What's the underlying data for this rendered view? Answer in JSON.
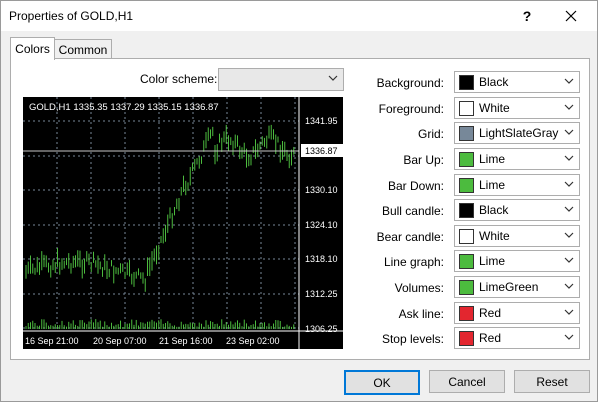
{
  "window": {
    "title": "Properties of GOLD,H1",
    "help_label": "?"
  },
  "tabs": [
    {
      "label": "Colors"
    },
    {
      "label": "Common"
    }
  ],
  "color_scheme": {
    "label": "Color scheme:",
    "value": ""
  },
  "chart": {
    "info_text": "GOLD,H1  1335.35 1337.29 1335.15 1336.87",
    "price_labels": [
      "1341.95",
      "1336.87",
      "1330.10",
      "1324.10",
      "1318.10",
      "1312.25",
      "1306.25"
    ],
    "time_labels": [
      "16 Sep 21:00",
      "20 Sep 07:00",
      "21 Sep 16:00",
      "23 Sep 02:00"
    ]
  },
  "color_rows": [
    {
      "label": "Background:",
      "value": "Black",
      "swatch": "#000000"
    },
    {
      "label": "Foreground:",
      "value": "White",
      "swatch": "#ffffff"
    },
    {
      "label": "Grid:",
      "value": "LightSlateGray",
      "swatch": "#778899"
    },
    {
      "label": "Bar Up:",
      "value": "Lime",
      "swatch": "#4cbb3e"
    },
    {
      "label": "Bar Down:",
      "value": "Lime",
      "swatch": "#4cbb3e"
    },
    {
      "label": "Bull candle:",
      "value": "Black",
      "swatch": "#000000"
    },
    {
      "label": "Bear candle:",
      "value": "White",
      "swatch": "#ffffff"
    },
    {
      "label": "Line graph:",
      "value": "Lime",
      "swatch": "#4cbb3e"
    },
    {
      "label": "Volumes:",
      "value": "LimeGreen",
      "swatch": "#4cbb3e"
    },
    {
      "label": "Ask line:",
      "value": "Red",
      "swatch": "#e3262f"
    },
    {
      "label": "Stop levels:",
      "value": "Red",
      "swatch": "#e3262f"
    }
  ],
  "buttons": {
    "ok": "OK",
    "cancel": "Cancel",
    "reset": "Reset"
  }
}
